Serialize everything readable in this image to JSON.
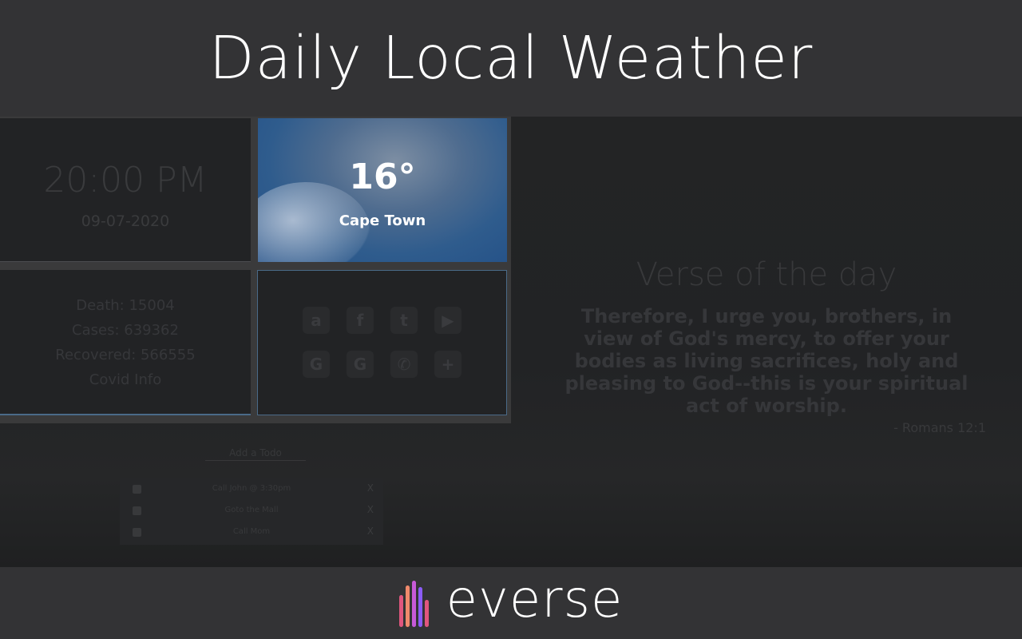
{
  "header": {
    "title": "Daily Local Weather"
  },
  "clock": {
    "time": "20:00 PM",
    "date": "09-07-2020"
  },
  "weather": {
    "temperature": "16°",
    "city": "Cape Town"
  },
  "covid": {
    "death": "Death: 15004",
    "cases": "Cases: 639362",
    "recovered": "Recovered: 566555",
    "label": "Covid Info"
  },
  "apps": [
    {
      "icon": "amazon-icon",
      "glyph": "a"
    },
    {
      "icon": "facebook-icon",
      "glyph": "f"
    },
    {
      "icon": "twitter-icon",
      "glyph": "t"
    },
    {
      "icon": "youtube-icon",
      "glyph": "▶"
    },
    {
      "icon": "google-icon",
      "glyph": "G"
    },
    {
      "icon": "google-icon",
      "glyph": "G"
    },
    {
      "icon": "whatsapp-icon",
      "glyph": "✆"
    },
    {
      "icon": "add-icon",
      "glyph": "+"
    }
  ],
  "verse": {
    "title": "Verse of the day",
    "text": "Therefore, I urge you, brothers, in view of God's mercy, to offer your bodies as living sacrifices, holy and pleasing to God--this is your spiritual act of worship.",
    "reference": "- Romans 12:1"
  },
  "todo": {
    "add_label": "Add a Todo",
    "items": [
      {
        "label": "Call John @ 3:30pm",
        "delete": "X"
      },
      {
        "label": "Goto the Mall",
        "delete": "X"
      },
      {
        "label": "Call Mom",
        "delete": "X"
      }
    ]
  },
  "footer": {
    "brand": "everse",
    "logo_colors": [
      "#e0567e",
      "#f08a6c",
      "#c75ad8",
      "#8b5cf6",
      "#e0567e"
    ]
  }
}
